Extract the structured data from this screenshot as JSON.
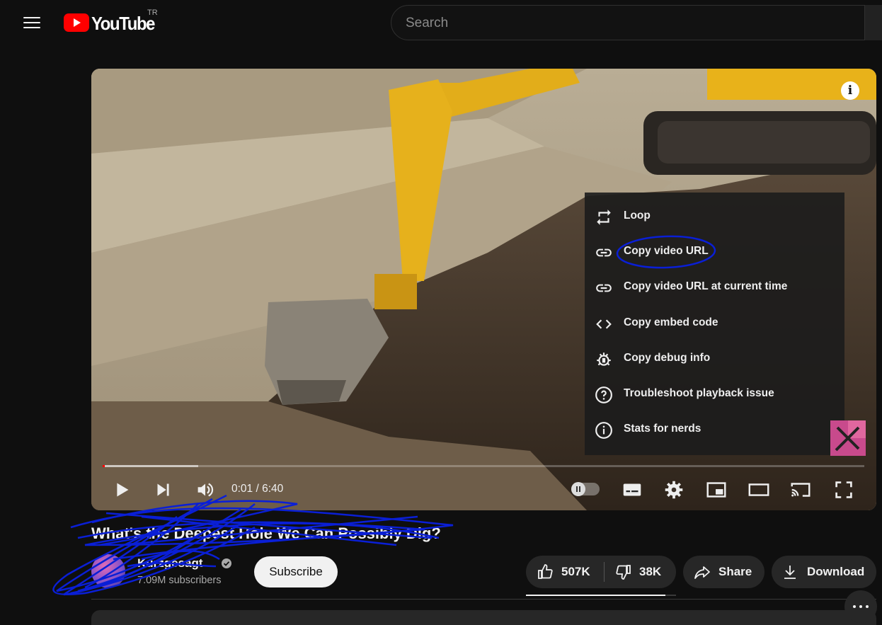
{
  "masthead": {
    "logo_text": "YouTube",
    "country_code": "TR",
    "search_placeholder": "Search"
  },
  "player": {
    "context_menu": [
      {
        "icon": "loop-icon",
        "label": "Loop"
      },
      {
        "icon": "link-icon",
        "label": "Copy video URL",
        "highlighted": true
      },
      {
        "icon": "link-icon",
        "label": "Copy video URL at current time"
      },
      {
        "icon": "code-icon",
        "label": "Copy embed code"
      },
      {
        "icon": "debug-icon",
        "label": "Copy debug info"
      },
      {
        "icon": "help-icon",
        "label": "Troubleshoot playback issue"
      },
      {
        "icon": "info-icon",
        "label": "Stats for nerds"
      }
    ],
    "time_current": "0:01",
    "time_total": "6:40",
    "time_display": "0:01 / 6:40",
    "progress_fraction": 0.0025,
    "buffered_fraction": 0.125,
    "autoplay": "paused-toggle"
  },
  "video": {
    "title": "What's the Deepest Hole We Can Possibly Dig?",
    "channel_name": "Kurzgesagt",
    "subscribers": "7.09M subscribers",
    "subscribe_label": "Subscribe",
    "likes": "507K",
    "dislikes": "38K",
    "share_label": "Share",
    "download_label": "Download",
    "like_ratio": 0.93
  },
  "colors": {
    "background": "#0f0f0f",
    "youtube_red": "#ff0000",
    "annotation_blue": "#0000ff"
  }
}
